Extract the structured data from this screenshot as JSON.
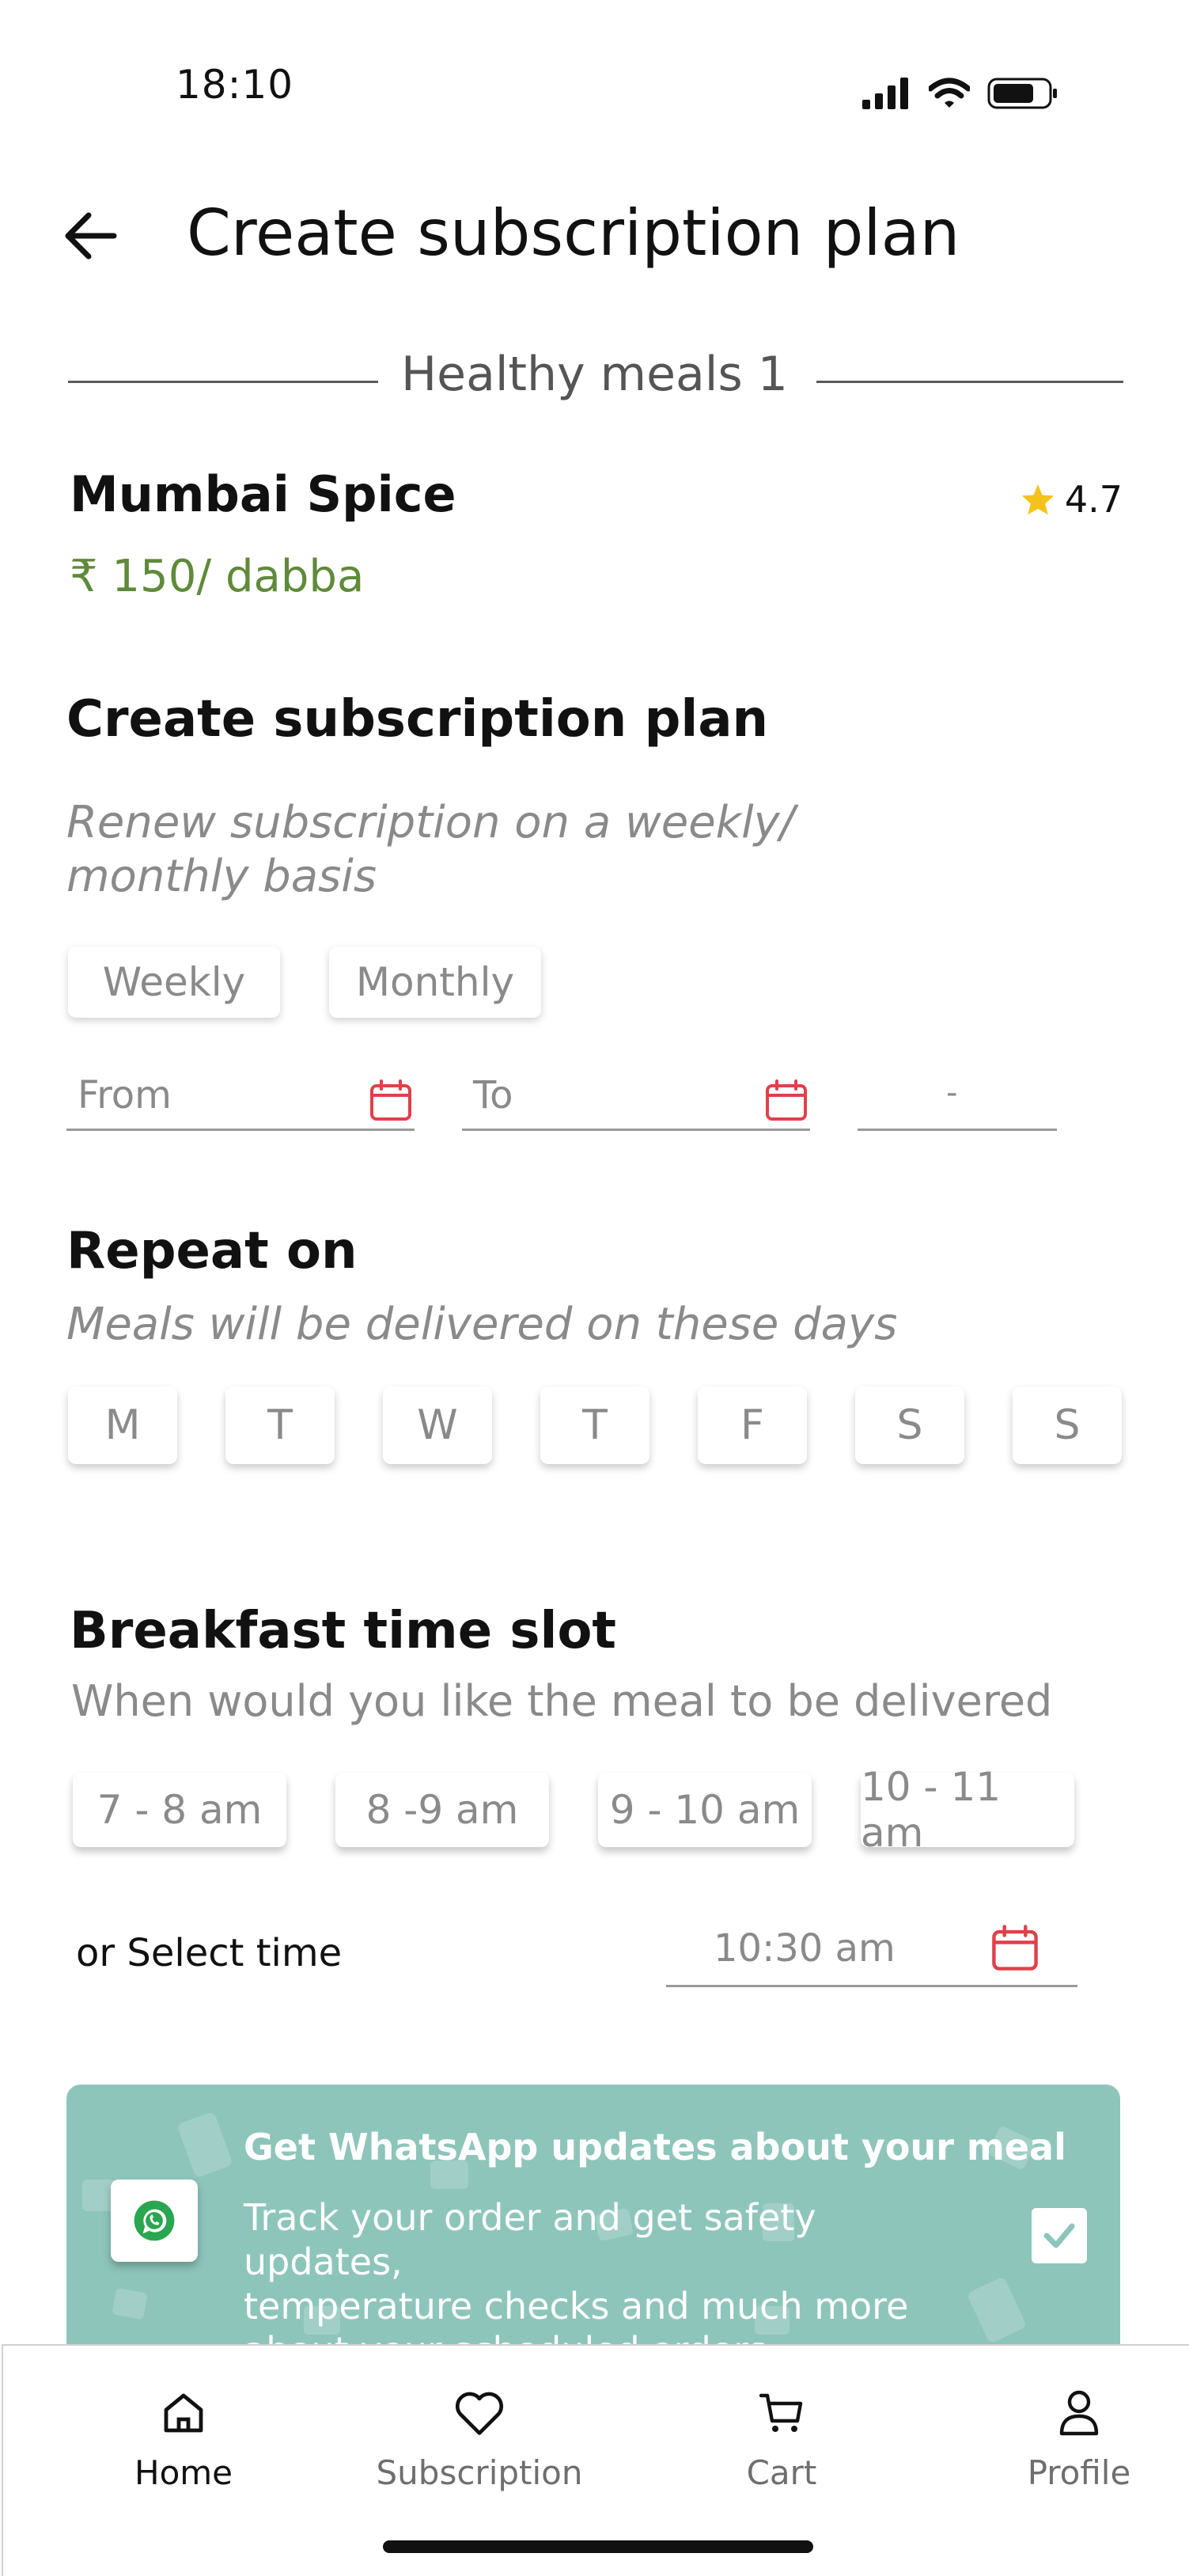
{
  "status_bar": {
    "time": "18:10"
  },
  "header": {
    "title": "Create subscription plan"
  },
  "section": {
    "name": "Healthy meals 1"
  },
  "restaurant": {
    "name": "Mumbai Spice",
    "rating": "4.7",
    "price": "₹ 150/ dabba"
  },
  "plan": {
    "title": "Create subscription plan",
    "subtitle_line1": "Renew subscription on a weekly/",
    "subtitle_line2": "monthly basis",
    "options": [
      "Weekly",
      "Monthly"
    ],
    "from_placeholder": "From",
    "to_placeholder": "To",
    "duration_placeholder": "-"
  },
  "repeat": {
    "title": "Repeat on",
    "subtitle": "Meals will be delivered on these days",
    "days": [
      "M",
      "T",
      "W",
      "T",
      "F",
      "S",
      "S"
    ]
  },
  "breakfast": {
    "title": "Breakfast time slot",
    "subtitle": "When would you like the meal to be delivered",
    "slots": [
      "7 - 8 am",
      "8 -9 am",
      "9 - 10 am",
      "10 - 11 am"
    ],
    "or_select_label": "or Select time",
    "selected_time": "10:30 am"
  },
  "whatsapp": {
    "title": "Get WhatsApp updates about your meal",
    "body_line1": "Track your order and get safety updates,",
    "body_line2": "temperature checks and much more",
    "body_line3": "about your scheduled orders",
    "checked": true,
    "bg_color": "#8dc5bb"
  },
  "bottom_nav": {
    "items": [
      {
        "label": "Home",
        "icon": "home-icon",
        "active": true
      },
      {
        "label": "Subscription",
        "icon": "heart-icon",
        "active": false
      },
      {
        "label": "Cart",
        "icon": "cart-icon",
        "active": false
      },
      {
        "label": "Profile",
        "icon": "user-icon",
        "active": false
      }
    ]
  },
  "colors": {
    "accent_red": "#e0404a",
    "price_green": "#5f8a3a",
    "star": "#f4c21b"
  }
}
